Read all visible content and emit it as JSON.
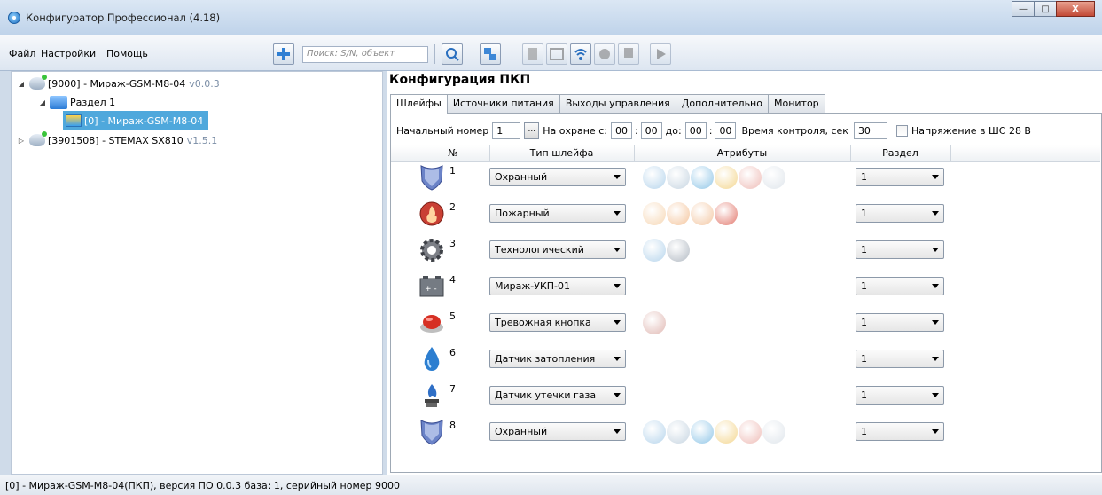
{
  "window": {
    "title": "Конфигуратор Профессионал (4.18)",
    "minimize": "—",
    "maximize": "□",
    "close": "X"
  },
  "menu": {
    "file": "Файл",
    "settings": "Настройки",
    "help": "Помощь"
  },
  "toolbar": {
    "search_placeholder": "Поиск: S/N, объект"
  },
  "tree": {
    "device1": {
      "id": "[9000] - Мираж-GSM-M8-04",
      "version": "v0.0.3"
    },
    "section": "Раздел 1",
    "selected": "[0] - Мираж-GSM-M8-04",
    "device2": {
      "id": "[3901508] - STEMAX SX810",
      "version": "v1.5.1"
    }
  },
  "panel": {
    "title": "Конфигурация ПКП",
    "tabs": [
      "Шлейфы",
      "Источники питания",
      "Выходы управления",
      "Дополнительно",
      "Монитор"
    ],
    "options": {
      "start_label": "Начальный номер",
      "start_value": "1",
      "dots": "...",
      "armed_from_label": "На охране с:",
      "from_h": "00",
      "from_m": "00",
      "to_label": "до:",
      "to_h": "00",
      "to_m": "00",
      "colon": ":",
      "control_label": "Время контроля, сек",
      "control_value": "30",
      "voltage_label": "Напряжение в ШС 28 В"
    },
    "columns": {
      "num": "№",
      "type": "Тип шлейфа",
      "attrs": "Атрибуты",
      "section": "Раздел"
    },
    "rows": [
      {
        "num": "1",
        "type": "Охранный",
        "section": "1",
        "icon": "shield-icon",
        "attrs": [
          "#9fc7e6",
          "#b5c8d8",
          "#6db4e0",
          "#f0c96c",
          "#e9a7a0",
          "#d5dde5"
        ]
      },
      {
        "num": "2",
        "type": "Пожарный",
        "section": "1",
        "icon": "fire-icon",
        "attrs": [
          "#f3c99b",
          "#f1b27c",
          "#efb585",
          "#d84a3b"
        ]
      },
      {
        "num": "3",
        "type": "Технологический",
        "section": "1",
        "icon": "gear-icon",
        "attrs": [
          "#9fc7e6",
          "#9aa4b0"
        ]
      },
      {
        "num": "4",
        "type": "Мираж-УКП-01",
        "section": "1",
        "icon": "battery-icon",
        "attrs": []
      },
      {
        "num": "5",
        "type": "Тревожная кнопка",
        "section": "1",
        "icon": "alarm-button-icon",
        "attrs": [
          "#d6a19a"
        ]
      },
      {
        "num": "6",
        "type": "Датчик затопления",
        "section": "1",
        "icon": "water-drop-icon",
        "attrs": []
      },
      {
        "num": "7",
        "type": "Датчик утечки газа",
        "section": "1",
        "icon": "gas-icon",
        "attrs": []
      },
      {
        "num": "8",
        "type": "Охранный",
        "section": "1",
        "icon": "shield-icon",
        "attrs": [
          "#9fc7e6",
          "#b5c8d8",
          "#6db4e0",
          "#f0c96c",
          "#e9a7a0",
          "#d5dde5"
        ]
      }
    ]
  },
  "status": "[0] - Мираж-GSM-M8-04(ПКП), версия ПО 0.0.3 база: 1, серийный номер 9000"
}
